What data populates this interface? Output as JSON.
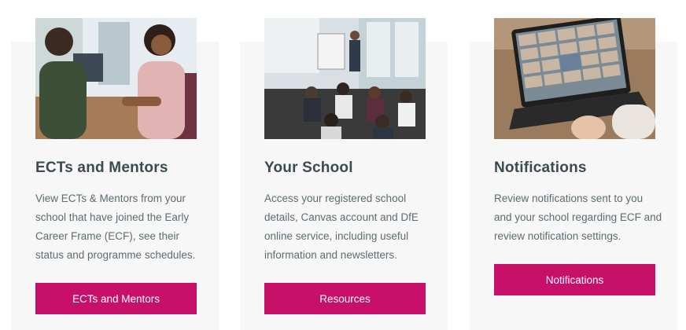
{
  "cards": [
    {
      "title": "ECTs and Mentors",
      "description": "View ECTs & Mentors from your school that have joined the Early Career Frame (ECF), see their status and programme schedules.",
      "button_label": "ECTs and Mentors"
    },
    {
      "title": "Your School",
      "description": "Access your registered school details, Canvas account and DfE online service, including useful information and newsletters.",
      "button_label": "Resources"
    },
    {
      "title": "Notifications",
      "description": "Review notifications sent to you and your school regarding ECF and review notification settings.",
      "button_label": "Notifications"
    }
  ],
  "colors": {
    "accent": "#c8106a",
    "card_background": "#f7f7f7",
    "title_text": "#3a4b52",
    "body_text": "#5e6b71"
  }
}
